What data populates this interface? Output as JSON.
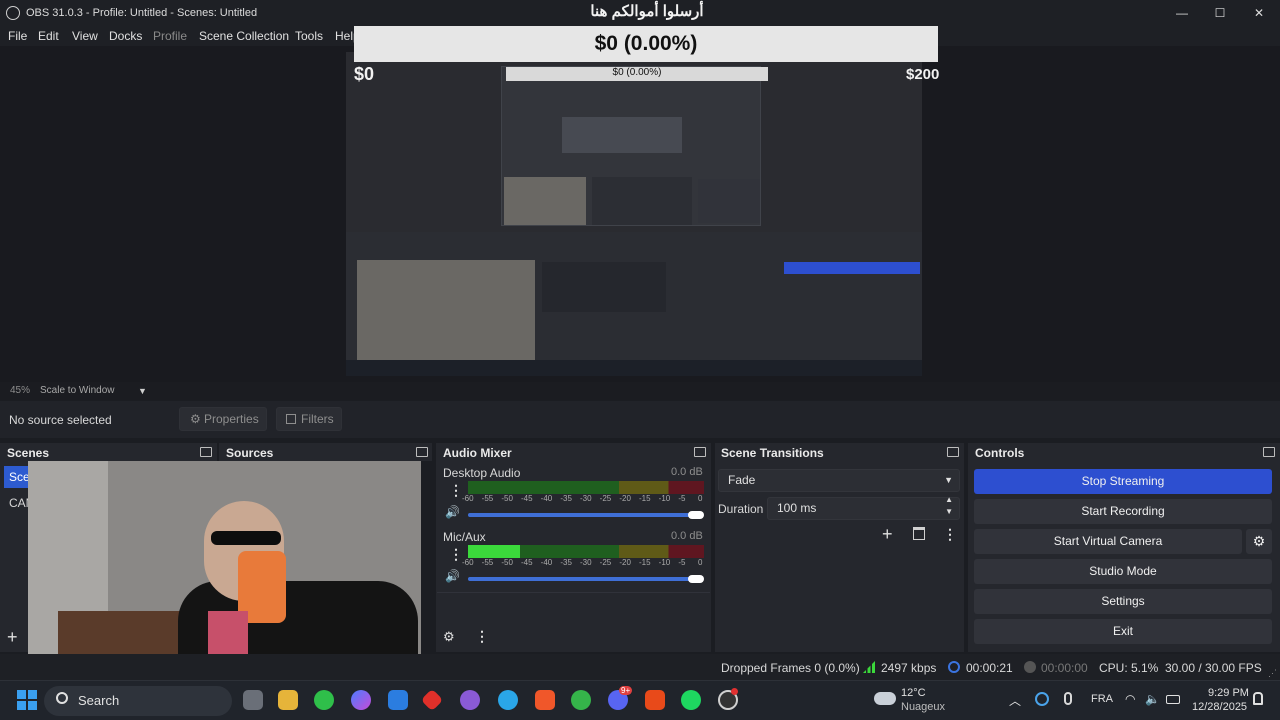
{
  "window": {
    "title": "OBS 31.0.3 - Profile: Untitled - Scenes: Untitled",
    "minimize": "—",
    "maximize": "☐",
    "close": "✕"
  },
  "menu": [
    "File",
    "Edit",
    "View",
    "Docks",
    "Profile",
    "Scene Collection",
    "Tools",
    "Help"
  ],
  "preview": {
    "overlay_title": "أرسلوا أموالكم هنا",
    "donation_amount": "$0 (0.00%)",
    "min_label": "$0",
    "max_label": "$200",
    "zoom": "45%",
    "scale_mode": "Scale to Window"
  },
  "source_toolbar": {
    "no_source": "No source selected",
    "properties": "Properties",
    "filters": "Filters"
  },
  "scenes": {
    "title": "Scenes",
    "items": [
      "Sce",
      "CAM"
    ]
  },
  "sources": {
    "title": "Sources"
  },
  "audio_mixer": {
    "title": "Audio Mixer",
    "channels": [
      {
        "name": "Desktop Audio",
        "db": "0.0 dB",
        "level": 0.0
      },
      {
        "name": "Mic/Aux",
        "db": "0.0 dB",
        "level": 0.22
      }
    ],
    "ticks": [
      "-60",
      "-55",
      "-50",
      "-45",
      "-40",
      "-35",
      "-30",
      "-25",
      "-20",
      "-15",
      "-10",
      "-5",
      "0"
    ]
  },
  "transitions": {
    "title": "Scene Transitions",
    "selected": "Fade",
    "duration_label": "Duration",
    "duration_value": "100 ms"
  },
  "controls": {
    "title": "Controls",
    "stop_streaming": "Stop Streaming",
    "start_recording": "Start Recording",
    "start_virtual_camera": "Start Virtual Camera",
    "studio_mode": "Studio Mode",
    "settings": "Settings",
    "exit": "Exit"
  },
  "status": {
    "dropped": "Dropped Frames 0 (0.0%)",
    "bitrate": "2497 kbps",
    "stream_time": "00:00:21",
    "rec_time": "00:00:00",
    "cpu": "CPU: 5.1%",
    "fps": "30.00 / 30.00 FPS"
  },
  "taskbar": {
    "search": "Search",
    "weather_temp": "12°C",
    "weather_desc": "Nuageux",
    "lang": "FRA",
    "time": "9:29 PM",
    "date": "12/28/2025",
    "discord_badge": "9+"
  },
  "colors": {
    "accent": "#2d4fd0",
    "meter_green": "#3bd93b"
  }
}
